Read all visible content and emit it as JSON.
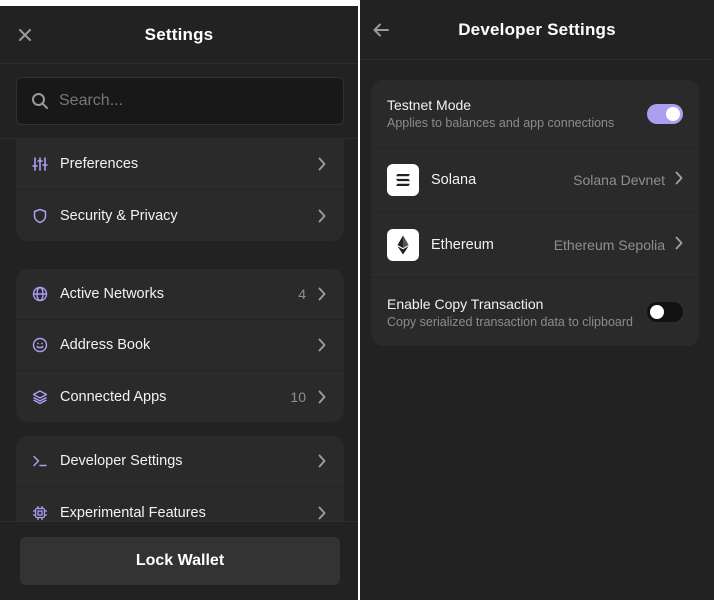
{
  "colors": {
    "background": "#222222",
    "card": "#2a2a2a",
    "accent": "#ab9ff2",
    "text_primary": "#ffffff",
    "text_secondary": "#8f8f8f",
    "icon_purple": "#ab9ff2"
  },
  "settings": {
    "title": "Settings",
    "close_icon": "close-icon",
    "search": {
      "placeholder": "Search...",
      "value": "",
      "icon": "search-icon"
    },
    "groups": [
      {
        "items": [
          {
            "label": "Preferences",
            "icon": "sliders-icon",
            "count": ""
          },
          {
            "label": "Security & Privacy",
            "icon": "shield-icon",
            "count": ""
          }
        ]
      },
      {
        "items": [
          {
            "label": "Active Networks",
            "icon": "globe-icon",
            "count": "4"
          },
          {
            "label": "Address Book",
            "icon": "smiley-icon",
            "count": ""
          },
          {
            "label": "Connected Apps",
            "icon": "layers-icon",
            "count": "10"
          }
        ]
      },
      {
        "items": [
          {
            "label": "Developer Settings",
            "icon": "terminal-icon",
            "count": ""
          },
          {
            "label": "Experimental Features",
            "icon": "chip-icon",
            "count": ""
          }
        ]
      }
    ],
    "lock_button_label": "Lock Wallet"
  },
  "developer": {
    "title": "Developer Settings",
    "back_icon": "back-arrow-icon",
    "testnet": {
      "title": "Testnet Mode",
      "description": "Applies to balances and app connections",
      "enabled": true
    },
    "networks": [
      {
        "name": "Solana",
        "value": "Solana Devnet",
        "icon": "solana-logo-icon"
      },
      {
        "name": "Ethereum",
        "value": "Ethereum Sepolia",
        "icon": "ethereum-logo-icon"
      }
    ],
    "copy_transaction": {
      "title": "Enable Copy Transaction",
      "description": "Copy serialized transaction data to clipboard",
      "enabled": false
    }
  }
}
